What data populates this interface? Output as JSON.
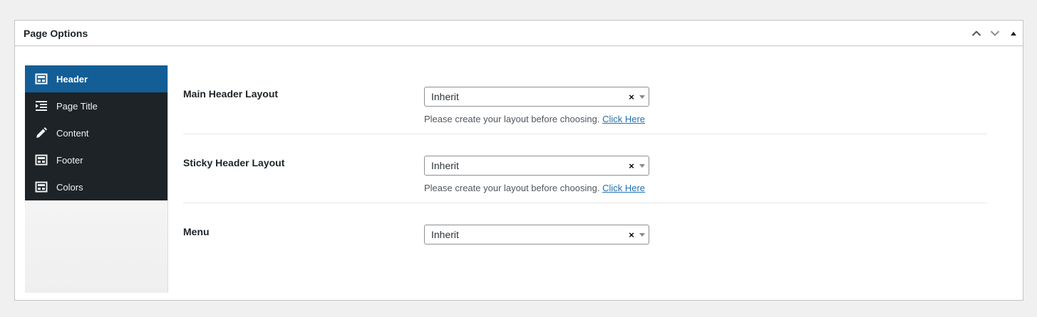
{
  "metabox": {
    "title": "Page Options",
    "actions": [
      "chevron-up-icon",
      "chevron-down-icon",
      "triangle-up-icon"
    ]
  },
  "sidebar": {
    "items": [
      {
        "label": "Header",
        "icon": "layout-icon",
        "active": true
      },
      {
        "label": "Page Title",
        "icon": "indent-icon",
        "active": false
      },
      {
        "label": "Content",
        "icon": "pencil-icon",
        "active": false
      },
      {
        "label": "Footer",
        "icon": "layout-icon",
        "active": false
      },
      {
        "label": "Colors",
        "icon": "layout-icon",
        "active": false
      }
    ]
  },
  "fields": [
    {
      "label": "Main Header Layout",
      "value": "Inherit",
      "clear": "×",
      "hint": "Please create your layout before choosing.",
      "link": "Click Here"
    },
    {
      "label": "Sticky Header Layout",
      "value": "Inherit",
      "clear": "×",
      "hint": "Please create your layout before choosing.",
      "link": "Click Here"
    },
    {
      "label": "Menu",
      "value": "Inherit",
      "clear": "×"
    }
  ],
  "colors": {
    "active_bg": "#135e96",
    "nav_bg": "#1d2327",
    "link": "#2271b1"
  }
}
